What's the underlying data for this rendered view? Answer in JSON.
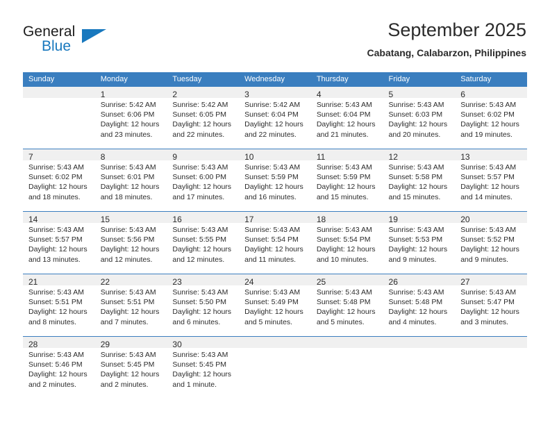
{
  "brand": {
    "name_part1": "General",
    "name_part2": "Blue",
    "flag_icon": "triangle-flag-icon"
  },
  "header": {
    "title": "September 2025",
    "subtitle": "Cabatang, Calabarzon, Philippines"
  },
  "colors": {
    "header_blue": "#3a7ebf",
    "brand_blue": "#1878be",
    "daynum_band": "#f0f0f0",
    "text": "#2b2b2b"
  },
  "weekday_headers": [
    "Sunday",
    "Monday",
    "Tuesday",
    "Wednesday",
    "Thursday",
    "Friday",
    "Saturday"
  ],
  "labels": {
    "sunrise_prefix": "Sunrise:",
    "sunset_prefix": "Sunset:",
    "daylight_prefix": "Daylight:"
  },
  "weeks": [
    [
      {
        "day": "",
        "sunrise": "",
        "sunset": "",
        "daylight_line1": "",
        "daylight_line2": "",
        "blank": true
      },
      {
        "day": "1",
        "sunrise": "Sunrise: 5:42 AM",
        "sunset": "Sunset: 6:06 PM",
        "daylight_line1": "Daylight: 12 hours",
        "daylight_line2": "and 23 minutes.",
        "blank": false
      },
      {
        "day": "2",
        "sunrise": "Sunrise: 5:42 AM",
        "sunset": "Sunset: 6:05 PM",
        "daylight_line1": "Daylight: 12 hours",
        "daylight_line2": "and 22 minutes.",
        "blank": false
      },
      {
        "day": "3",
        "sunrise": "Sunrise: 5:42 AM",
        "sunset": "Sunset: 6:04 PM",
        "daylight_line1": "Daylight: 12 hours",
        "daylight_line2": "and 22 minutes.",
        "blank": false
      },
      {
        "day": "4",
        "sunrise": "Sunrise: 5:43 AM",
        "sunset": "Sunset: 6:04 PM",
        "daylight_line1": "Daylight: 12 hours",
        "daylight_line2": "and 21 minutes.",
        "blank": false
      },
      {
        "day": "5",
        "sunrise": "Sunrise: 5:43 AM",
        "sunset": "Sunset: 6:03 PM",
        "daylight_line1": "Daylight: 12 hours",
        "daylight_line2": "and 20 minutes.",
        "blank": false
      },
      {
        "day": "6",
        "sunrise": "Sunrise: 5:43 AM",
        "sunset": "Sunset: 6:02 PM",
        "daylight_line1": "Daylight: 12 hours",
        "daylight_line2": "and 19 minutes.",
        "blank": false
      }
    ],
    [
      {
        "day": "7",
        "sunrise": "Sunrise: 5:43 AM",
        "sunset": "Sunset: 6:02 PM",
        "daylight_line1": "Daylight: 12 hours",
        "daylight_line2": "and 18 minutes.",
        "blank": false
      },
      {
        "day": "8",
        "sunrise": "Sunrise: 5:43 AM",
        "sunset": "Sunset: 6:01 PM",
        "daylight_line1": "Daylight: 12 hours",
        "daylight_line2": "and 18 minutes.",
        "blank": false
      },
      {
        "day": "9",
        "sunrise": "Sunrise: 5:43 AM",
        "sunset": "Sunset: 6:00 PM",
        "daylight_line1": "Daylight: 12 hours",
        "daylight_line2": "and 17 minutes.",
        "blank": false
      },
      {
        "day": "10",
        "sunrise": "Sunrise: 5:43 AM",
        "sunset": "Sunset: 5:59 PM",
        "daylight_line1": "Daylight: 12 hours",
        "daylight_line2": "and 16 minutes.",
        "blank": false
      },
      {
        "day": "11",
        "sunrise": "Sunrise: 5:43 AM",
        "sunset": "Sunset: 5:59 PM",
        "daylight_line1": "Daylight: 12 hours",
        "daylight_line2": "and 15 minutes.",
        "blank": false
      },
      {
        "day": "12",
        "sunrise": "Sunrise: 5:43 AM",
        "sunset": "Sunset: 5:58 PM",
        "daylight_line1": "Daylight: 12 hours",
        "daylight_line2": "and 15 minutes.",
        "blank": false
      },
      {
        "day": "13",
        "sunrise": "Sunrise: 5:43 AM",
        "sunset": "Sunset: 5:57 PM",
        "daylight_line1": "Daylight: 12 hours",
        "daylight_line2": "and 14 minutes.",
        "blank": false
      }
    ],
    [
      {
        "day": "14",
        "sunrise": "Sunrise: 5:43 AM",
        "sunset": "Sunset: 5:57 PM",
        "daylight_line1": "Daylight: 12 hours",
        "daylight_line2": "and 13 minutes.",
        "blank": false
      },
      {
        "day": "15",
        "sunrise": "Sunrise: 5:43 AM",
        "sunset": "Sunset: 5:56 PM",
        "daylight_line1": "Daylight: 12 hours",
        "daylight_line2": "and 12 minutes.",
        "blank": false
      },
      {
        "day": "16",
        "sunrise": "Sunrise: 5:43 AM",
        "sunset": "Sunset: 5:55 PM",
        "daylight_line1": "Daylight: 12 hours",
        "daylight_line2": "and 12 minutes.",
        "blank": false
      },
      {
        "day": "17",
        "sunrise": "Sunrise: 5:43 AM",
        "sunset": "Sunset: 5:54 PM",
        "daylight_line1": "Daylight: 12 hours",
        "daylight_line2": "and 11 minutes.",
        "blank": false
      },
      {
        "day": "18",
        "sunrise": "Sunrise: 5:43 AM",
        "sunset": "Sunset: 5:54 PM",
        "daylight_line1": "Daylight: 12 hours",
        "daylight_line2": "and 10 minutes.",
        "blank": false
      },
      {
        "day": "19",
        "sunrise": "Sunrise: 5:43 AM",
        "sunset": "Sunset: 5:53 PM",
        "daylight_line1": "Daylight: 12 hours",
        "daylight_line2": "and 9 minutes.",
        "blank": false
      },
      {
        "day": "20",
        "sunrise": "Sunrise: 5:43 AM",
        "sunset": "Sunset: 5:52 PM",
        "daylight_line1": "Daylight: 12 hours",
        "daylight_line2": "and 9 minutes.",
        "blank": false
      }
    ],
    [
      {
        "day": "21",
        "sunrise": "Sunrise: 5:43 AM",
        "sunset": "Sunset: 5:51 PM",
        "daylight_line1": "Daylight: 12 hours",
        "daylight_line2": "and 8 minutes.",
        "blank": false
      },
      {
        "day": "22",
        "sunrise": "Sunrise: 5:43 AM",
        "sunset": "Sunset: 5:51 PM",
        "daylight_line1": "Daylight: 12 hours",
        "daylight_line2": "and 7 minutes.",
        "blank": false
      },
      {
        "day": "23",
        "sunrise": "Sunrise: 5:43 AM",
        "sunset": "Sunset: 5:50 PM",
        "daylight_line1": "Daylight: 12 hours",
        "daylight_line2": "and 6 minutes.",
        "blank": false
      },
      {
        "day": "24",
        "sunrise": "Sunrise: 5:43 AM",
        "sunset": "Sunset: 5:49 PM",
        "daylight_line1": "Daylight: 12 hours",
        "daylight_line2": "and 5 minutes.",
        "blank": false
      },
      {
        "day": "25",
        "sunrise": "Sunrise: 5:43 AM",
        "sunset": "Sunset: 5:48 PM",
        "daylight_line1": "Daylight: 12 hours",
        "daylight_line2": "and 5 minutes.",
        "blank": false
      },
      {
        "day": "26",
        "sunrise": "Sunrise: 5:43 AM",
        "sunset": "Sunset: 5:48 PM",
        "daylight_line1": "Daylight: 12 hours",
        "daylight_line2": "and 4 minutes.",
        "blank": false
      },
      {
        "day": "27",
        "sunrise": "Sunrise: 5:43 AM",
        "sunset": "Sunset: 5:47 PM",
        "daylight_line1": "Daylight: 12 hours",
        "daylight_line2": "and 3 minutes.",
        "blank": false
      }
    ],
    [
      {
        "day": "28",
        "sunrise": "Sunrise: 5:43 AM",
        "sunset": "Sunset: 5:46 PM",
        "daylight_line1": "Daylight: 12 hours",
        "daylight_line2": "and 2 minutes.",
        "blank": false
      },
      {
        "day": "29",
        "sunrise": "Sunrise: 5:43 AM",
        "sunset": "Sunset: 5:45 PM",
        "daylight_line1": "Daylight: 12 hours",
        "daylight_line2": "and 2 minutes.",
        "blank": false
      },
      {
        "day": "30",
        "sunrise": "Sunrise: 5:43 AM",
        "sunset": "Sunset: 5:45 PM",
        "daylight_line1": "Daylight: 12 hours",
        "daylight_line2": "and 1 minute.",
        "blank": false
      },
      {
        "day": "",
        "sunrise": "",
        "sunset": "",
        "daylight_line1": "",
        "daylight_line2": "",
        "blank": true
      },
      {
        "day": "",
        "sunrise": "",
        "sunset": "",
        "daylight_line1": "",
        "daylight_line2": "",
        "blank": true
      },
      {
        "day": "",
        "sunrise": "",
        "sunset": "",
        "daylight_line1": "",
        "daylight_line2": "",
        "blank": true
      },
      {
        "day": "",
        "sunrise": "",
        "sunset": "",
        "daylight_line1": "",
        "daylight_line2": "",
        "blank": true
      }
    ]
  ]
}
